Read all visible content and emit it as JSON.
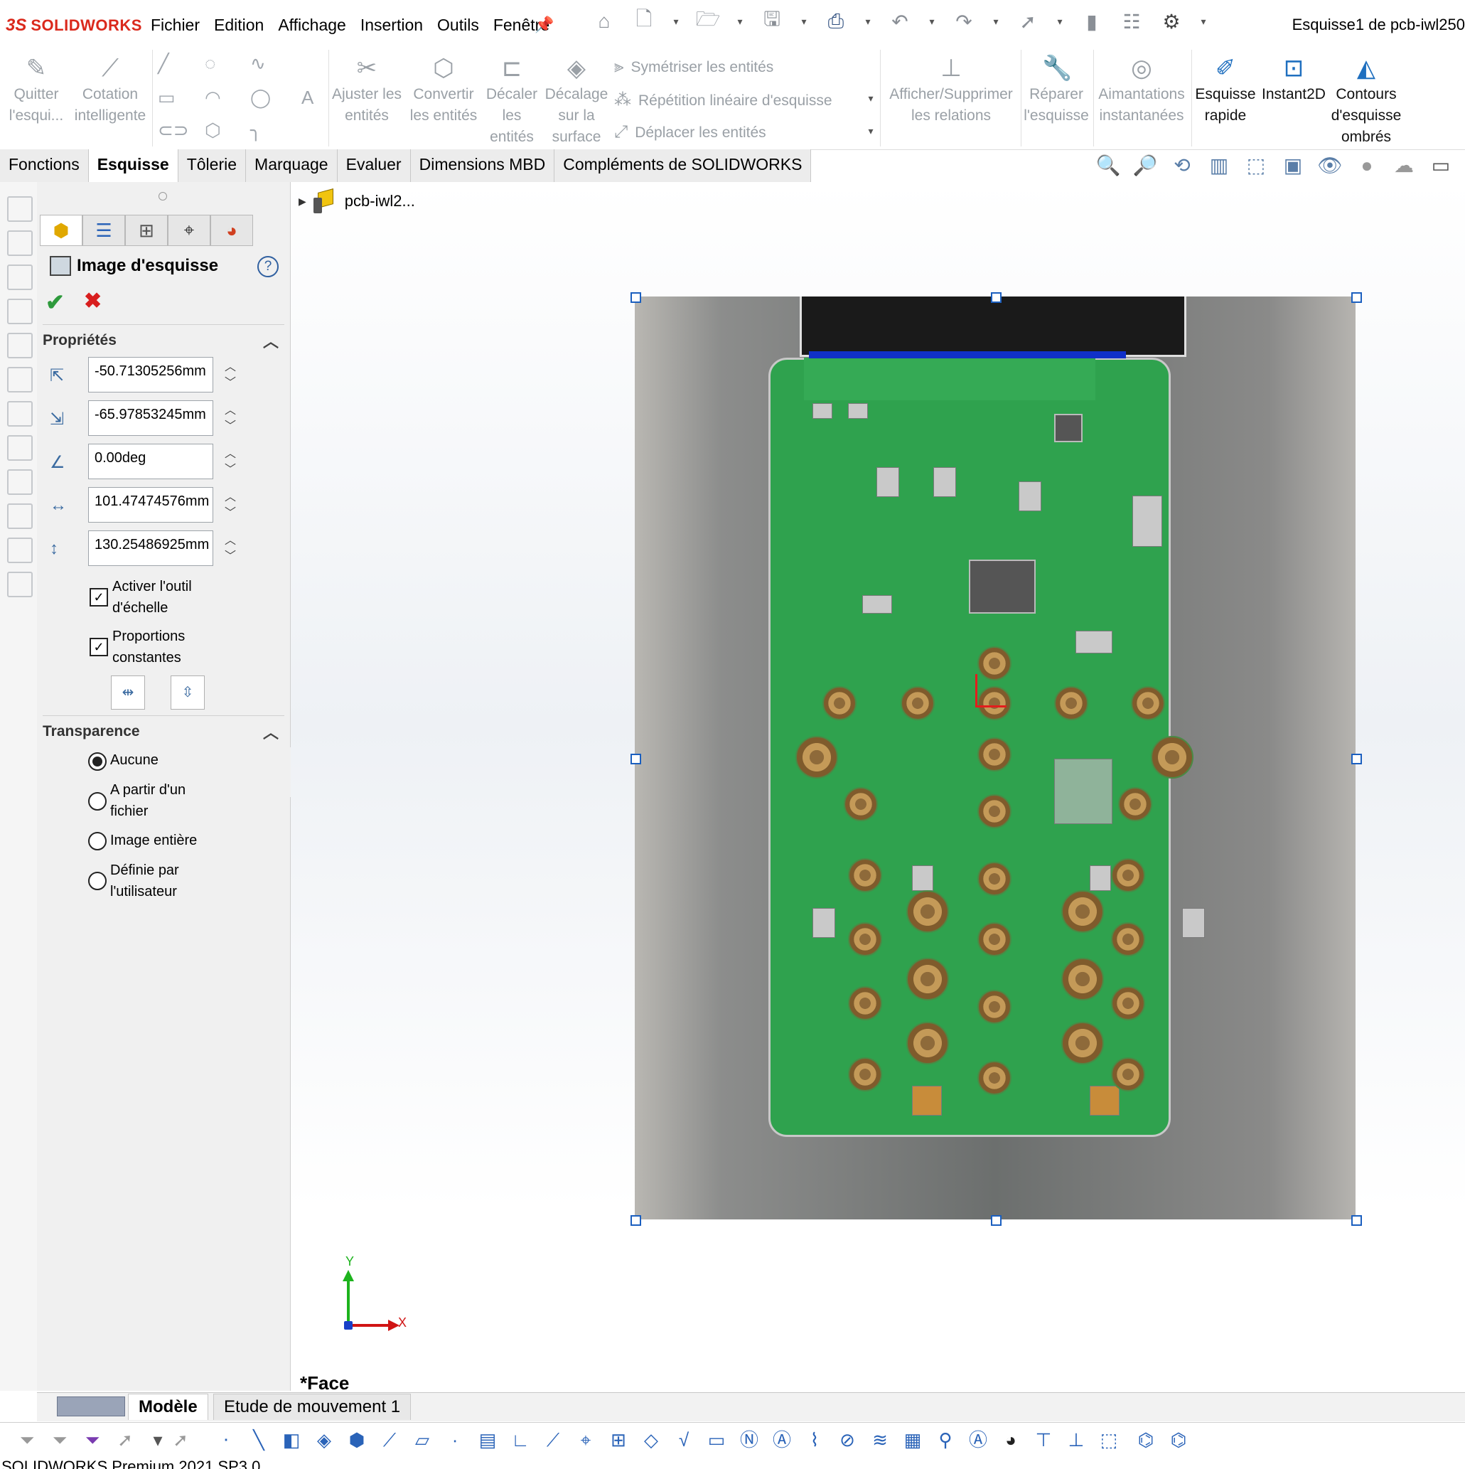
{
  "app": {
    "brand": "SOLIDWORKS",
    "logo_mark": "3S",
    "document_title": "Esquisse1 de pcb-iwl250"
  },
  "menu": [
    "Fichier",
    "Edition",
    "Affichage",
    "Insertion",
    "Outils",
    "Fenêtre"
  ],
  "command_manager": {
    "quitter": "Quitter l'esqui...",
    "cotation": "Cotation intelligente",
    "ajuster": "Ajuster les entités",
    "convertir": "Convertir les entités",
    "decaler": "Décaler les entités",
    "decalage_surface": "Décalage sur la surface",
    "symetriser": "Symétriser les entités",
    "repetition": "Répétition linéaire d'esquisse",
    "deplacer": "Déplacer les entités",
    "relations": "Afficher/Supprimer les relations",
    "reparer": "Réparer l'esquisse",
    "aimantations": "Aimantations instantanées",
    "esquisse_rapide": "Esquisse rapide",
    "instant2d": "Instant2D",
    "contours": "Contours d'esquisse ombrés"
  },
  "tabs": [
    "Fonctions",
    "Esquisse",
    "Tôlerie",
    "Marquage",
    "Evaluer",
    "Dimensions MBD",
    "Compléments de SOLIDWORKS"
  ],
  "active_tab": "Esquisse",
  "property_manager": {
    "title": "Image d'esquisse",
    "help": "?",
    "group_properties": "Propriétés",
    "fields": [
      {
        "icon": "origin-x-icon",
        "value": "-50.71305256mm"
      },
      {
        "icon": "origin-y-icon",
        "value": "-65.97853245mm"
      },
      {
        "icon": "angle-icon",
        "value": "0.00deg"
      },
      {
        "icon": "width-icon",
        "value": "101.47474576mm"
      },
      {
        "icon": "height-icon",
        "value": "130.25486925mm"
      }
    ],
    "checkboxes": [
      {
        "label_line1": "Activer l'outil",
        "label_line2": "d'échelle",
        "checked": true
      },
      {
        "label_line1": "Proportions",
        "label_line2": "constantes",
        "checked": true
      }
    ],
    "group_transparency": "Transparence",
    "radios": [
      {
        "line1": "Aucune",
        "line2": "",
        "selected": true
      },
      {
        "line1": "A partir d'un",
        "line2": "fichier",
        "selected": false
      },
      {
        "line1": "Image entière",
        "line2": "",
        "selected": false
      },
      {
        "line1": "Définie par",
        "line2": "l'utilisateur",
        "selected": false
      }
    ]
  },
  "feature_tree": {
    "root_label": "pcb-iwl2..."
  },
  "triad": {
    "x": "X",
    "y": "Y"
  },
  "view_name": "*Face",
  "bottom_tabs": {
    "model": "Modèle",
    "motion": "Etude de mouvement 1"
  },
  "status_bar": "SOLIDWORKS Premium 2021 SP3.0"
}
